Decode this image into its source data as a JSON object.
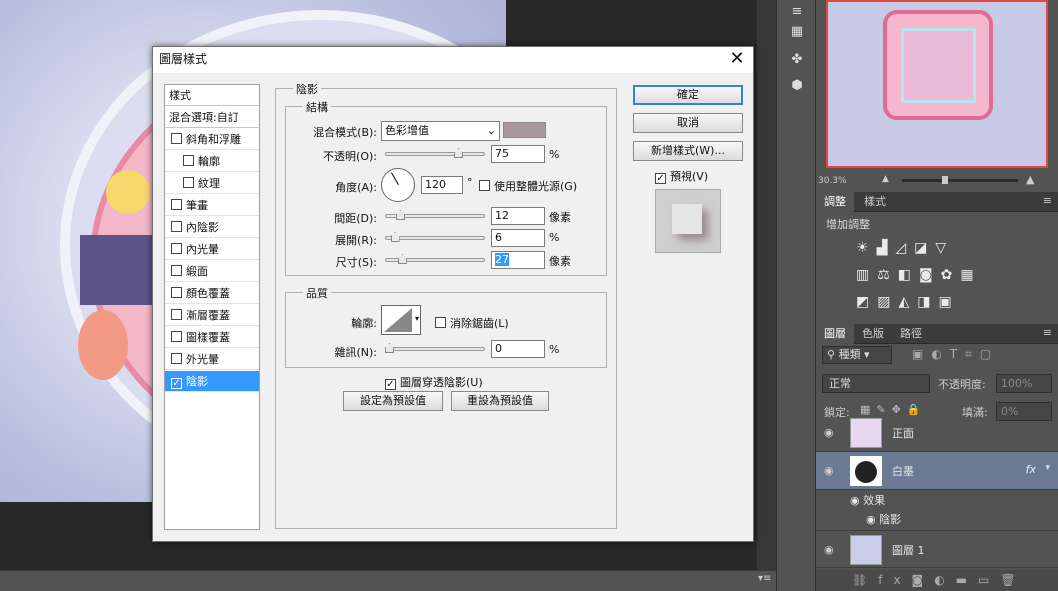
{
  "status": {
    "zoom": "30.3%"
  },
  "panels": {
    "adjust_tabs": [
      "調整",
      "樣式"
    ],
    "adjust_subtitle": "增加調整",
    "layers_tabs": [
      "圖層",
      "色版",
      "路徑"
    ],
    "filter_kind": "種類",
    "blend_mode": "正常",
    "opacity_label": "不透明度:",
    "opacity_value": "100%",
    "lock_label": "鎖定:",
    "fill_label": "填滿:",
    "fill_value": "0%",
    "layers": [
      {
        "name": "正面"
      },
      {
        "name": "白墨",
        "fx": "fx"
      },
      {
        "name": "效果"
      },
      {
        "name": "陰影"
      },
      {
        "name": "圖層 1"
      }
    ]
  },
  "dialog": {
    "title": "圖層樣式",
    "close": "✕",
    "styles_header": "樣式",
    "blend_options": "混合選項:自訂",
    "style_items": [
      {
        "label": "斜角和浮雕",
        "checked": false,
        "indent": false
      },
      {
        "label": "輪廓",
        "checked": false,
        "indent": true
      },
      {
        "label": "紋理",
        "checked": false,
        "indent": true
      },
      {
        "label": "筆畫",
        "checked": false,
        "indent": false
      },
      {
        "label": "內陰影",
        "checked": false,
        "indent": false
      },
      {
        "label": "內光暈",
        "checked": false,
        "indent": false
      },
      {
        "label": "緞面",
        "checked": false,
        "indent": false
      },
      {
        "label": "顏色覆蓋",
        "checked": false,
        "indent": false
      },
      {
        "label": "漸層覆蓋",
        "checked": false,
        "indent": false
      },
      {
        "label": "圖樣覆蓋",
        "checked": false,
        "indent": false
      },
      {
        "label": "外光暈",
        "checked": false,
        "indent": false
      },
      {
        "label": "陰影",
        "checked": true,
        "indent": false,
        "selected": true
      }
    ],
    "section_title": "陰影",
    "structure_label": "結構",
    "blend_mode_label": "混合模式(B):",
    "blend_mode_value": "色彩增值",
    "shadow_color": "#a9999f",
    "opacity_label": "不透明(O):",
    "opacity_value": "75",
    "opacity_unit": "%",
    "angle_label": "角度(A):",
    "angle_value": "120",
    "angle_unit": "°",
    "global_light": "使用整體光源(G)",
    "distance_label": "間距(D):",
    "distance_value": "12",
    "distance_unit": "像素",
    "spread_label": "展開(R):",
    "spread_value": "6",
    "spread_unit": "%",
    "size_label": "尺寸(S):",
    "size_value": "27",
    "size_unit": "像素",
    "quality_label": "品質",
    "contour_label": "輪廓:",
    "anti_alias": "消除鋸齒(L)",
    "noise_label": "雜訊(N):",
    "noise_value": "0",
    "noise_unit": "%",
    "knockout": "圖層穿透陰影(U)",
    "make_default": "設定為預設值",
    "reset_default": "重設為預設值",
    "ok": "確定",
    "cancel": "取消",
    "new_style": "新增樣式(W)...",
    "preview": "預視(V)",
    "slider_levels": {
      "opacity": 0.75,
      "distance": 0.12,
      "spread": 0.06,
      "size": 0.14,
      "noise": 0.0
    }
  }
}
